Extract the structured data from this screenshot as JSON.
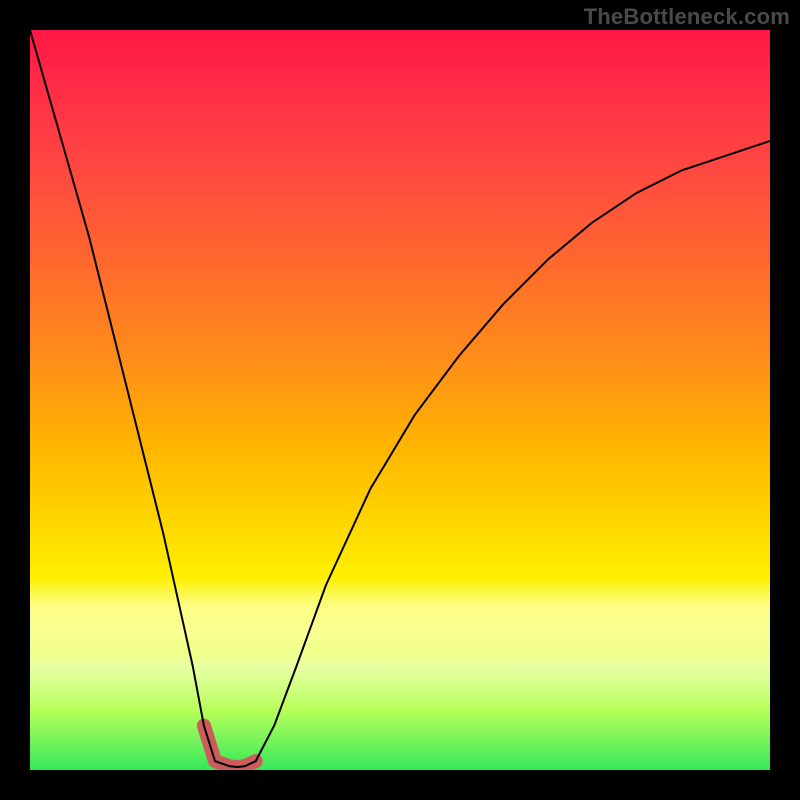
{
  "watermark": "TheBottleneck.com",
  "chart_data": {
    "type": "line",
    "title": "",
    "xlabel": "",
    "ylabel": "",
    "y_gradient_note": "vertical color gradient from red (top) through orange/yellow to green (bottom)",
    "series": [
      {
        "name": "curve",
        "stroke": "#000000",
        "stroke_width": 2,
        "x": [
          0.0,
          0.02,
          0.04,
          0.06,
          0.08,
          0.1,
          0.12,
          0.14,
          0.16,
          0.18,
          0.2,
          0.22,
          0.235,
          0.25,
          0.27,
          0.28,
          0.29,
          0.305,
          0.33,
          0.36,
          0.4,
          0.46,
          0.52,
          0.58,
          0.64,
          0.7,
          0.76,
          0.82,
          0.88,
          0.94,
          1.0
        ],
        "y": [
          1.0,
          0.93,
          0.86,
          0.79,
          0.72,
          0.64,
          0.56,
          0.48,
          0.4,
          0.32,
          0.23,
          0.14,
          0.06,
          0.012,
          0.005,
          0.004,
          0.005,
          0.012,
          0.06,
          0.14,
          0.25,
          0.38,
          0.48,
          0.56,
          0.63,
          0.69,
          0.74,
          0.78,
          0.81,
          0.83,
          0.85
        ]
      },
      {
        "name": "highlight-segment",
        "stroke": "#cd5c5c",
        "stroke_width": 14,
        "x": [
          0.235,
          0.25,
          0.27,
          0.28,
          0.29,
          0.305
        ],
        "y": [
          0.06,
          0.012,
          0.005,
          0.004,
          0.005,
          0.012
        ]
      }
    ],
    "xlim": [
      0,
      1
    ],
    "ylim": [
      0,
      1
    ]
  }
}
